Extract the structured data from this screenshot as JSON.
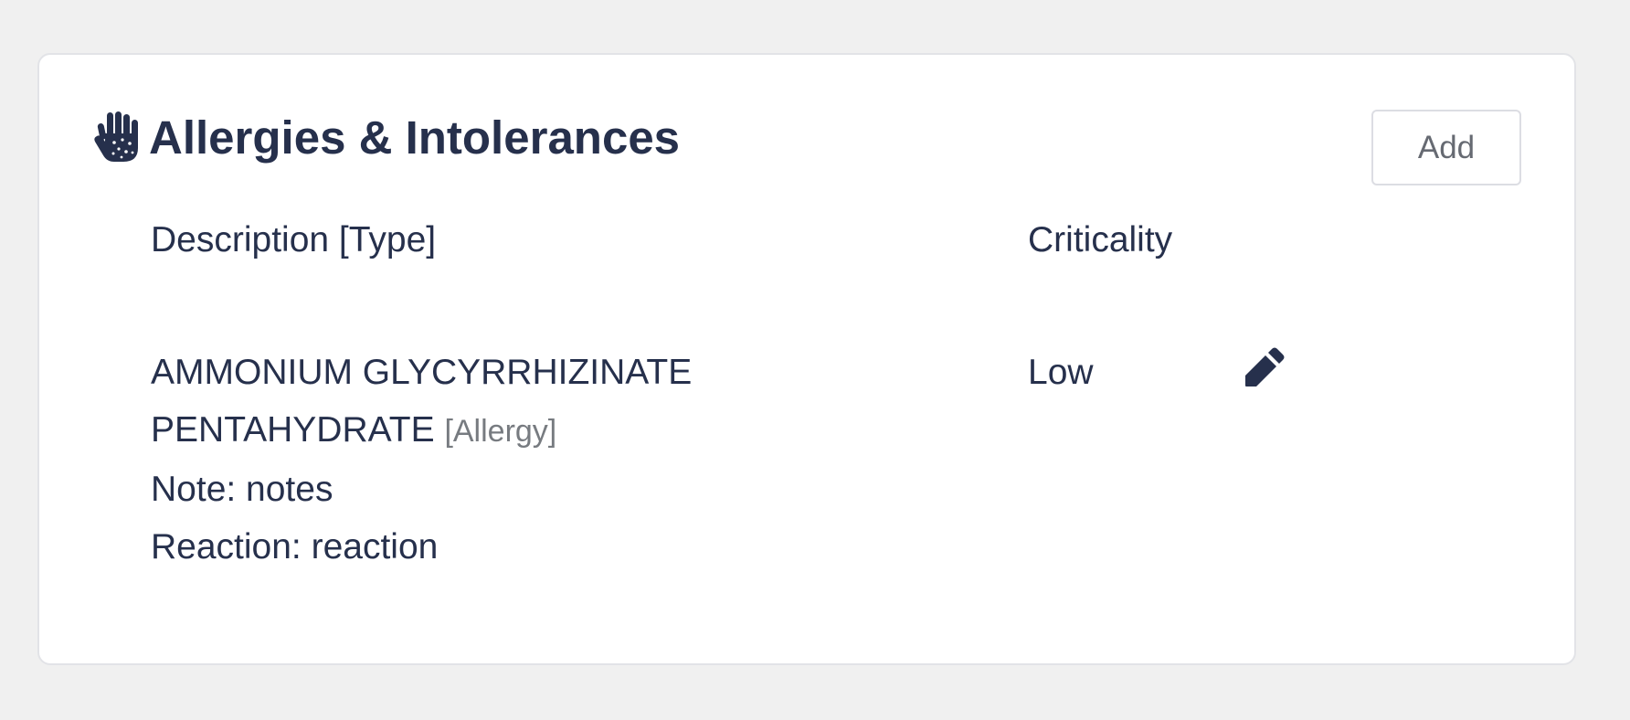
{
  "card": {
    "title": "Allergies & Intolerances",
    "title_icon": "allergies-hand-icon",
    "add_label": "Add"
  },
  "table": {
    "columns": [
      "Description [Type]",
      "Criticality"
    ],
    "rows": [
      {
        "description_line1": "AMMONIUM GLYCYRRHIZINATE",
        "description_line2": "PENTAHYDRATE",
        "type": "[Allergy]",
        "note": "Note: notes",
        "reaction": "Reaction: reaction",
        "criticality": "Low",
        "action_icon": "pencil-icon"
      }
    ]
  },
  "colors": {
    "text": "#26304c",
    "muted": "#777b80",
    "background": "#f0f0f0",
    "card": "#ffffff"
  }
}
